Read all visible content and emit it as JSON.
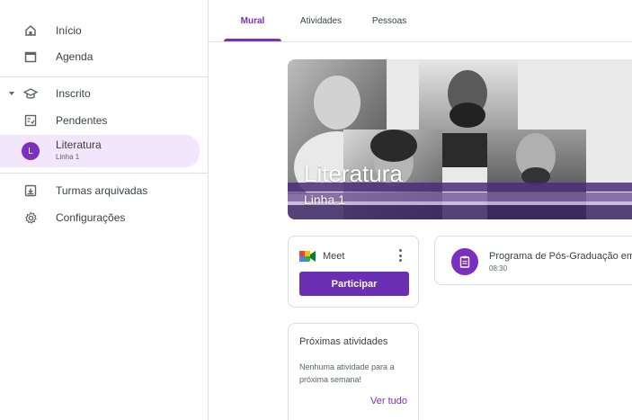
{
  "sidebar": {
    "items": [
      {
        "label": "Início",
        "icon": "home-icon"
      },
      {
        "label": "Agenda",
        "icon": "calendar-icon"
      },
      {
        "label": "Inscrito",
        "icon": "enrolled-icon"
      },
      {
        "label": "Pendentes",
        "icon": "todo-icon"
      },
      {
        "label": "Literatura",
        "sub": "Linha 1",
        "avatar": "L"
      },
      {
        "label": "Turmas arquivadas",
        "icon": "archive-icon"
      },
      {
        "label": "Configurações",
        "icon": "gear-icon"
      }
    ]
  },
  "tabs": [
    {
      "label": "Mural",
      "active": true
    },
    {
      "label": "Atividades",
      "active": false
    },
    {
      "label": "Pessoas",
      "active": false
    }
  ],
  "banner": {
    "title": "Literatura",
    "subtitle": "Linha 1"
  },
  "meet": {
    "title": "Meet",
    "button": "Participar"
  },
  "announcement": {
    "title": "Programa de Pós-Graduação em",
    "time": "08:30"
  },
  "upcoming": {
    "title": "Próximas atividades",
    "empty": "Nenhuma atividade para a próxima semana!",
    "link": "Ver tudo"
  },
  "colors": {
    "accent": "#7b2fbf",
    "active_bg": "#f1e6fb",
    "button": "#6b2fb3"
  }
}
